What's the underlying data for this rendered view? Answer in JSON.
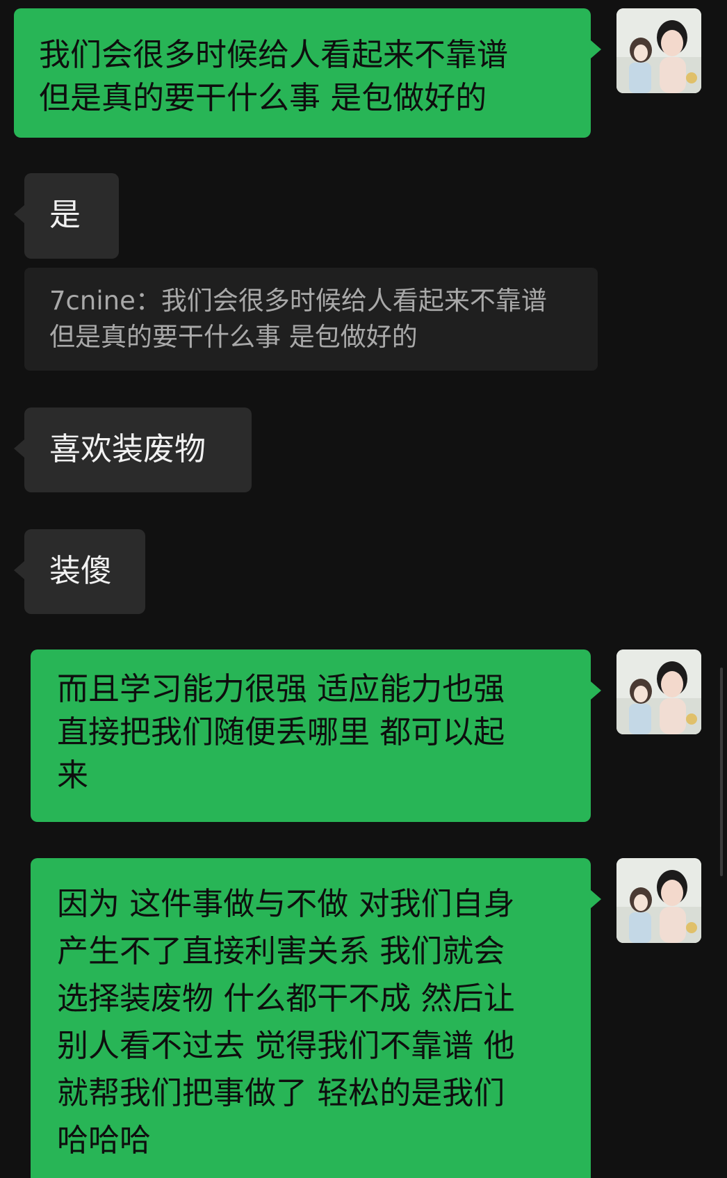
{
  "messages": [
    {
      "id": "m1",
      "side": "out",
      "text": "我们会很多时候给人看起来不靠谱\n但是真的要干什么事 是包做好的"
    },
    {
      "id": "m2",
      "side": "in",
      "text": "是"
    },
    {
      "id": "m2q",
      "type": "quote",
      "author": "7cnine",
      "separator": "：",
      "text": "我们会很多时候给人看起来不靠谱 但是真的要干什么事 是包做好的"
    },
    {
      "id": "m3",
      "side": "in",
      "text": "喜欢装废物"
    },
    {
      "id": "m4",
      "side": "in",
      "text": "装傻"
    },
    {
      "id": "m5",
      "side": "out",
      "text": "而且学习能力很强 适应能力也强\n直接把我们随便丢哪里 都可以起\n来"
    },
    {
      "id": "m6",
      "side": "out",
      "text": "因为 这件事做与不做 对我们自身\n产生不了直接利害关系 我们就会\n选择装废物 什么都干不成 然后让\n别人看不过去 觉得我们不靠谱 他\n就帮我们把事做了 轻松的是我们\n哈哈哈"
    }
  ],
  "colors": {
    "background": "#111111",
    "outgoing_bubble": "#28b556",
    "incoming_bubble": "#2b2b2b",
    "quote_bg": "#1f1f1f"
  },
  "icons": {
    "avatar": "user-avatar-icon"
  }
}
